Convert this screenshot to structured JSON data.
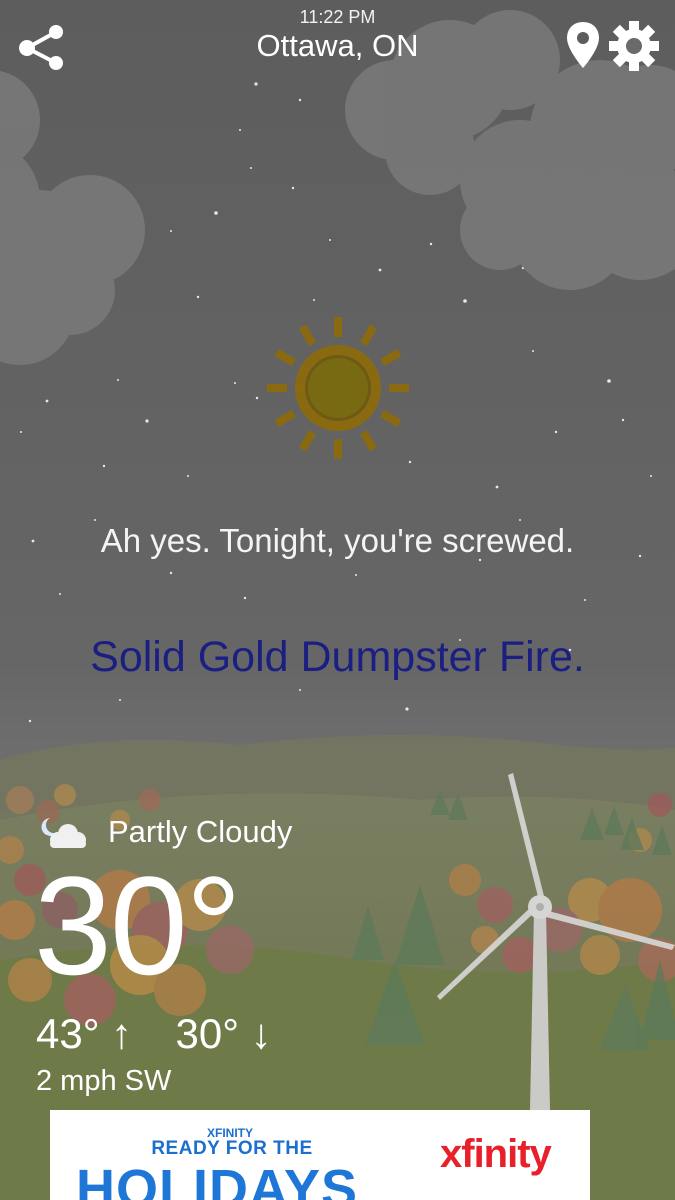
{
  "status": {
    "time": "11:22 PM"
  },
  "header": {
    "location": "Ottawa, ON",
    "share_icon": "share-icon",
    "pin_icon": "location-pin-icon",
    "settings_icon": "gear-icon"
  },
  "message": {
    "tagline": "Ah yes. Tonight, you're screwed.",
    "title": "Solid Gold Dumpster Fire."
  },
  "current": {
    "condition_icon": "partly-cloudy-night-icon",
    "condition": "Partly Cloudy",
    "temperature": "30°",
    "high": "43° ↑",
    "low": "30° ↓",
    "wind": "2 mph SW"
  },
  "ad": {
    "small_text": "XFINITY",
    "headline": "READY FOR THE",
    "big_text": "HOLIDAYS",
    "brand": "xfinity"
  },
  "colors": {
    "sky": "#5d5d5d",
    "title": "#1c1f82",
    "sun": "#8a6a10",
    "ad_blue": "#1e76d6",
    "ad_red": "#e8202a"
  }
}
